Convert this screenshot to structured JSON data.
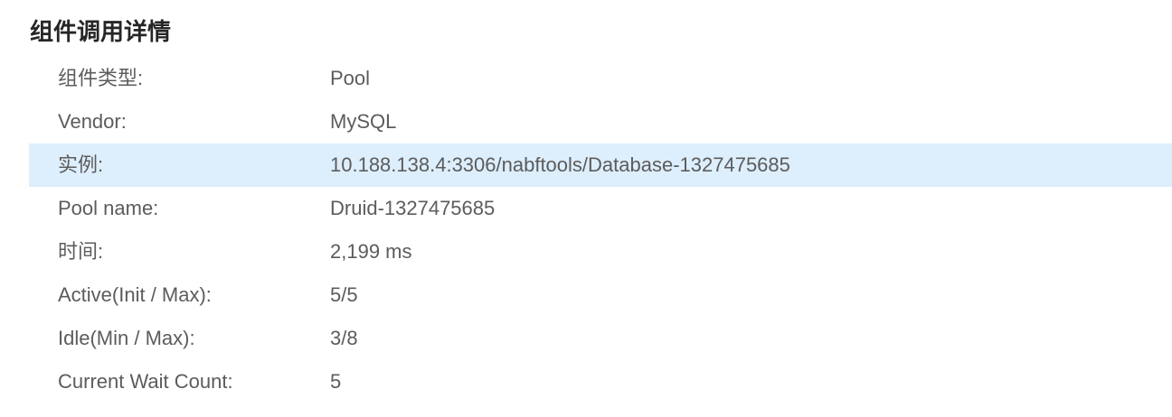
{
  "section": {
    "title": "组件调用详情"
  },
  "rows": [
    {
      "label": "组件类型:",
      "value": "Pool"
    },
    {
      "label": "Vendor:",
      "value": "MySQL"
    },
    {
      "label": "实例:",
      "value": "10.188.138.4:3306/nabftools/Database-1327475685"
    },
    {
      "label": "Pool name:",
      "value": "Druid-1327475685"
    },
    {
      "label": "时间:",
      "value": "2,199 ms"
    },
    {
      "label": "Active(Init / Max):",
      "value": "5/5"
    },
    {
      "label": "Idle(Min / Max):",
      "value": "3/8"
    },
    {
      "label": "Current Wait Count:",
      "value": "5"
    }
  ],
  "colors": {
    "highlight_row_background": "#ddeefc",
    "title_text": "#262626",
    "body_text": "#5c5c5c"
  }
}
